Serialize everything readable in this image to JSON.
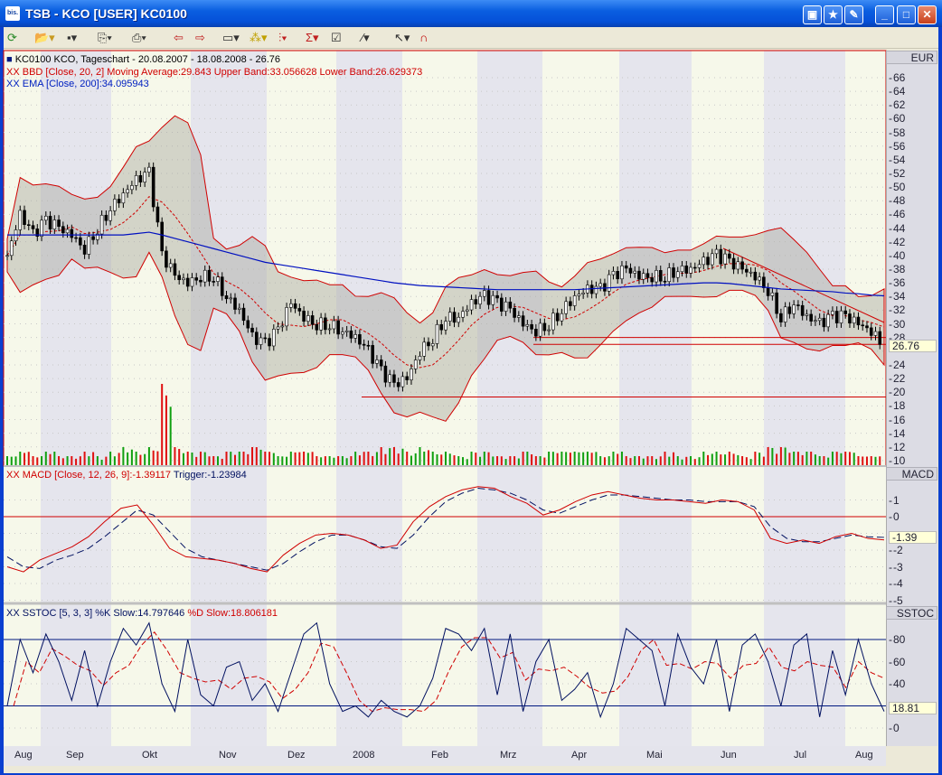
{
  "window": {
    "title": "TSB - KCO [USER] KC0100",
    "icon_text": "bis.",
    "buttons": [
      "tile",
      "favorite",
      "edit",
      "minimize",
      "maximize",
      "close"
    ]
  },
  "toolbar": {
    "icons": [
      "refresh",
      "open",
      "save",
      "copy",
      "print",
      "back-chart",
      "forward-chart",
      "window",
      "indicators",
      "chart-type",
      "formula",
      "properties",
      "draw-line",
      "pointer",
      "magnet"
    ]
  },
  "legend": {
    "price": "KC0100  KCO, Tageschart - 20.08.2007 - 18.08.2008 - 26.76",
    "bbd": "XX BBD [Close, 20, 2] Moving Average:29.843 Upper Band:33.056628 Lower Band:26.629373",
    "ema": "XX EMA [Close, 200]:34.095943",
    "macd": "XX MACD [Close, 12, 26, 9]:-1.39117",
    "trigger": "Trigger:-1.23984",
    "sstoc_k": "XX SSTOC [5, 3, 3] %K Slow:14.797646",
    "sstoc_d": "%D Slow:18.806181"
  },
  "axes": {
    "price_unit": "EUR",
    "price_last": "26.76",
    "macd_label": "MACD",
    "macd_last": "-1.39",
    "sstoc_label": "SSTOC",
    "sstoc_last": "18.81",
    "price_ticks": [
      "66",
      "64",
      "62",
      "60",
      "58",
      "56",
      "54",
      "52",
      "50",
      "48",
      "46",
      "44",
      "42",
      "40",
      "38",
      "36",
      "34",
      "32",
      "30",
      "28",
      "24",
      "22",
      "20",
      "18",
      "16",
      "14",
      "12",
      "10"
    ],
    "macd_ticks": [
      "1",
      "0",
      "-2",
      "-3",
      "-4",
      "-5"
    ],
    "sstoc_ticks": [
      "80",
      "60",
      "40",
      "0"
    ]
  },
  "months": [
    "Aug",
    "Sep",
    "Okt",
    "Nov",
    "Dez",
    "2008",
    "Feb",
    "Mrz",
    "Apr",
    "Mai",
    "Jun",
    "Jul",
    "Aug"
  ],
  "chart_data": {
    "type": "line",
    "title": "KC0100 KCO, Tageschart - 20.08.2007 - 18.08.2008",
    "x_range": [
      "20.08.2007",
      "18.08.2008"
    ],
    "price_ylim": [
      10,
      66
    ],
    "close": [
      40,
      46,
      43,
      45,
      44,
      43,
      41,
      44,
      47,
      49,
      51,
      52,
      40,
      37,
      36,
      37,
      37,
      34,
      32,
      28,
      27,
      29,
      33,
      31,
      30,
      30,
      29,
      28,
      26,
      23,
      21,
      22,
      26,
      28,
      31,
      31,
      33,
      34,
      33,
      32,
      30,
      29,
      30,
      32,
      34,
      35,
      35,
      37,
      38,
      37,
      37,
      37,
      38,
      38,
      39,
      40,
      39,
      38,
      37,
      35,
      31,
      33,
      31,
      30,
      31,
      31,
      30,
      29,
      26.76
    ],
    "ema": [
      43,
      43,
      43,
      43,
      43,
      43,
      43,
      43,
      43,
      43,
      43.2,
      43.4,
      43,
      42.5,
      42,
      41.5,
      41,
      40.5,
      40,
      39.5,
      39,
      38.7,
      38.4,
      38.1,
      37.8,
      37.5,
      37.2,
      36.9,
      36.6,
      36.3,
      36,
      35.8,
      35.6,
      35.5,
      35.4,
      35.3,
      35.2,
      35.1,
      35,
      35,
      35,
      35,
      35,
      35,
      35,
      35.1,
      35.2,
      35.3,
      35.4,
      35.5,
      35.6,
      35.7,
      35.8,
      35.9,
      36,
      36,
      35.9,
      35.7,
      35.5,
      35.3,
      35.1,
      35,
      34.9,
      34.8,
      34.7,
      34.5,
      34.4,
      34.2,
      34.1
    ],
    "volume": [
      2,
      3,
      2,
      3,
      2,
      2,
      3,
      2,
      3,
      4,
      3,
      4,
      18,
      4,
      3,
      3,
      2,
      3,
      3,
      4,
      3,
      2,
      3,
      3,
      2,
      2,
      2,
      3,
      3,
      4,
      4,
      3,
      4,
      3,
      3,
      2,
      3,
      3,
      2,
      2,
      3,
      2,
      3,
      3,
      3,
      3,
      2,
      3,
      2,
      2,
      2,
      3,
      2,
      2,
      3,
      3,
      3,
      2,
      3,
      4,
      4,
      3,
      3,
      2,
      3,
      3,
      2,
      2,
      2
    ],
    "macd_ylim": [
      -5.5,
      2
    ],
    "macd": [
      -3,
      -3.3,
      -2.6,
      -2.2,
      -1.8,
      -1.2,
      -0.3,
      0.5,
      0.7,
      -0.5,
      -1.9,
      -2.4,
      -2.5,
      -2.6,
      -2.8,
      -3.1,
      -3.3,
      -2.3,
      -1.6,
      -1.1,
      -1,
      -1.1,
      -1.4,
      -1.9,
      -1.7,
      -0.3,
      0.6,
      1.2,
      1.6,
      1.8,
      1.7,
      1.2,
      0.8,
      0.1,
      0.4,
      0.9,
      1.3,
      1.5,
      1.3,
      1.1,
      1,
      1,
      0.9,
      0.8,
      1,
      0.9,
      0.4,
      -1.3,
      -1.6,
      -1.4,
      -1.6,
      -1.2,
      -1.0,
      -1.3,
      -1.39
    ],
    "trigger": [
      -2.4,
      -3,
      -3.1,
      -2.6,
      -2.3,
      -1.9,
      -1.2,
      -0.4,
      0.4,
      0.1,
      -0.9,
      -1.9,
      -2.4,
      -2.6,
      -2.8,
      -3.0,
      -3.2,
      -2.8,
      -2.1,
      -1.5,
      -1.1,
      -1.1,
      -1.4,
      -1.8,
      -1.9,
      -1.1,
      0,
      0.9,
      1.4,
      1.7,
      1.6,
      1.4,
      1,
      0.4,
      0.2,
      0.6,
      1,
      1.3,
      1.3,
      1.2,
      1.1,
      1,
      1,
      0.9,
      0.9,
      0.9,
      0.6,
      -0.6,
      -1.3,
      -1.5,
      -1.5,
      -1.3,
      -1.1,
      -1.2,
      -1.24
    ],
    "sstoc_ylim": [
      -10,
      100
    ],
    "sstoc_k": [
      20,
      80,
      50,
      85,
      60,
      25,
      70,
      20,
      60,
      90,
      75,
      95,
      40,
      15,
      80,
      30,
      20,
      55,
      60,
      25,
      40,
      15,
      50,
      85,
      95,
      40,
      15,
      20,
      10,
      25,
      15,
      10,
      20,
      45,
      90,
      85,
      70,
      90,
      30,
      85,
      15,
      60,
      80,
      25,
      35,
      50,
      10,
      40,
      90,
      80,
      70,
      20,
      85,
      55,
      40,
      80,
      15,
      75,
      85,
      60,
      20,
      75,
      85,
      10,
      70,
      30,
      80,
      40,
      15
    ]
  }
}
